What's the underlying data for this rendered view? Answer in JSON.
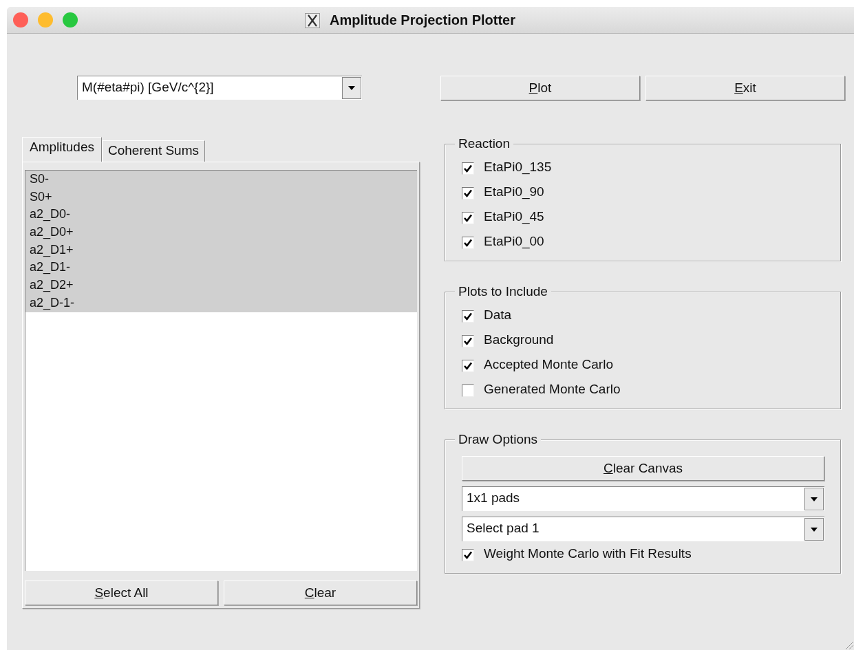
{
  "window": {
    "title": "Amplitude Projection Plotter"
  },
  "variable_select": {
    "value": "M(#eta#pi) [GeV/c^{2}]"
  },
  "top_buttons": [
    {
      "label": "Plot",
      "mnemonic": true
    },
    {
      "label": "Exit",
      "mnemonic": true
    }
  ],
  "tabs": [
    {
      "label": "Amplitudes",
      "selected": true
    },
    {
      "label": "Coherent Sums",
      "selected": false
    }
  ],
  "amplitudes": [
    {
      "label": "S0-",
      "selected": true
    },
    {
      "label": "S0+",
      "selected": true
    },
    {
      "label": "a2_D0-",
      "selected": true
    },
    {
      "label": "a2_D0+",
      "selected": true
    },
    {
      "label": "a2_D1+",
      "selected": true
    },
    {
      "label": "a2_D1-",
      "selected": true
    },
    {
      "label": "a2_D2+",
      "selected": true
    },
    {
      "label": "a2_D-1-",
      "selected": true
    }
  ],
  "list_buttons": [
    {
      "label": "Select All",
      "mnemonic": true
    },
    {
      "label": "Clear",
      "mnemonic": true
    }
  ],
  "groups": [
    {
      "title": "Reaction",
      "items": [
        {
          "kind": "checkbox",
          "label": "EtaPi0_135",
          "checked": true
        },
        {
          "kind": "checkbox",
          "label": "EtaPi0_90",
          "checked": true
        },
        {
          "kind": "checkbox",
          "label": "EtaPi0_45",
          "checked": true
        },
        {
          "kind": "checkbox",
          "label": "EtaPi0_00",
          "checked": true
        }
      ]
    },
    {
      "title": "Plots to Include",
      "items": [
        {
          "kind": "checkbox",
          "label": "Data",
          "checked": true
        },
        {
          "kind": "checkbox",
          "label": "Background",
          "checked": true
        },
        {
          "kind": "checkbox",
          "label": "Accepted Monte Carlo",
          "checked": true
        },
        {
          "kind": "checkbox",
          "label": "Generated Monte Carlo",
          "checked": false
        }
      ]
    },
    {
      "title": "Draw Options",
      "items": [
        {
          "kind": "button",
          "label": "Clear Canvas",
          "mnemonic": true
        },
        {
          "kind": "dropdown",
          "value": "1x1 pads"
        },
        {
          "kind": "dropdown",
          "value": "Select pad 1"
        },
        {
          "kind": "checkbox",
          "label": "Weight Monte Carlo with Fit Results",
          "checked": true
        }
      ]
    }
  ]
}
